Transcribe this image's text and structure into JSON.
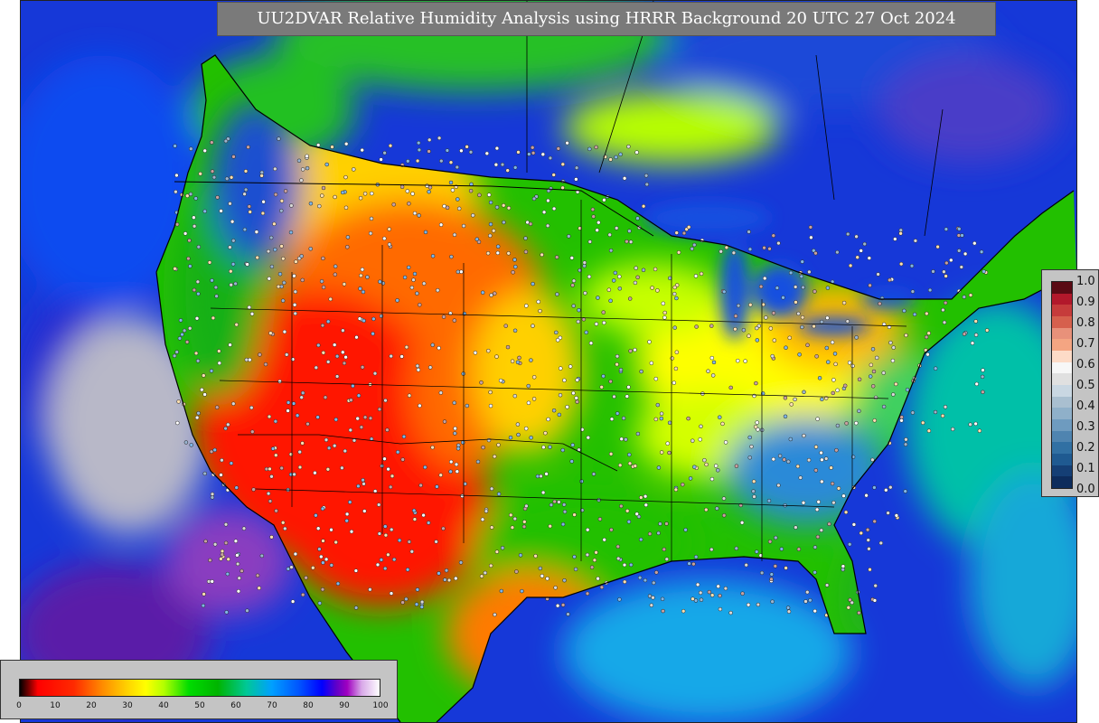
{
  "title": "UU2DVAR Relative Humidity Analysis using HRRR Background 20 UTC 27 Oct 2024",
  "side_colorbar": {
    "ticks": [
      "1.0",
      "0.9",
      "0.8",
      "0.7",
      "0.6",
      "0.5",
      "0.4",
      "0.3",
      "0.2",
      "0.1",
      "0.0"
    ],
    "colors": [
      "#5a0a14",
      "#b2182b",
      "#c63b3b",
      "#d6604d",
      "#e8917a",
      "#f4a582",
      "#fddbc7",
      "#f7f7f7",
      "#e0e0e0",
      "#c9d7e2",
      "#a9bfd0",
      "#8fb0c9",
      "#6e9bbf",
      "#4f84b0",
      "#3170a3",
      "#1f5a91",
      "#153f75",
      "#0d2c5c"
    ]
  },
  "bottom_colorbar": {
    "ticks": [
      "0",
      "10",
      "20",
      "30",
      "40",
      "50",
      "60",
      "70",
      "80",
      "90",
      "100"
    ]
  }
}
